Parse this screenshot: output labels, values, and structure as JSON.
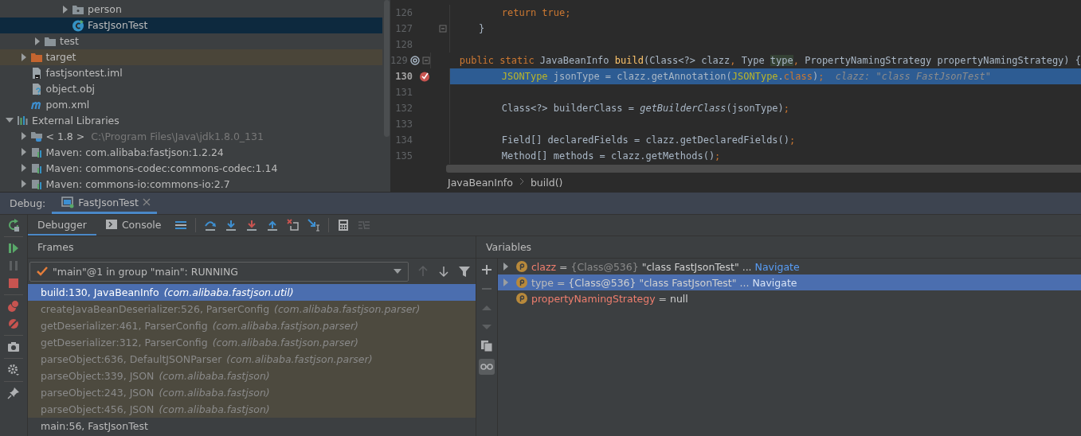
{
  "project_tree": [
    {
      "children": [
        {
          "children": [
            {
              "children": [
                {
                  "children": [
                    {
                      "label": "person",
                      "kind": "package",
                      "expanded": false,
                      "selected": false,
                      "ignored": false
                    },
                    {
                      "label": "FastJsonTest",
                      "kind": "class",
                      "selected": true,
                      "ignored": false
                    }
                  ]
                }
              ]
            },
            {
              "label": "test",
              "kind": "folder",
              "expanded": false,
              "selected": false,
              "ignored": false
            }
          ]
        },
        {
          "label": "target",
          "kind": "excluded_folder",
          "expanded": false,
          "selected": false,
          "ignored": true
        },
        {
          "label": "fastjsontest.iml",
          "kind": "module_file",
          "selected": false,
          "ignored": false
        },
        {
          "label": "object.obj",
          "kind": "unknown_file",
          "selected": false,
          "ignored": false
        },
        {
          "label": "pom.xml",
          "kind": "maven_file",
          "selected": false,
          "ignored": false
        }
      ]
    },
    {
      "label": "External Libraries",
      "kind": "libraries",
      "expanded": true,
      "selected": false,
      "ignored": false,
      "children": [
        {
          "label": "< 1.8 >",
          "path": "C:\\Program Files\\Java\\jdk1.8.0_131",
          "kind": "jdk",
          "expanded": false,
          "selected": false,
          "ignored": false
        },
        {
          "label": "Maven: com.alibaba:fastjson:1.2.24",
          "kind": "library",
          "expanded": false,
          "selected": false,
          "ignored": false
        },
        {
          "label": "Maven: commons-codec:commons-codec:1.14",
          "kind": "library",
          "expanded": false,
          "selected": false,
          "ignored": false
        },
        {
          "label": "Maven: commons-io:commons-io:2.7",
          "kind": "library",
          "expanded": false,
          "selected": false,
          "ignored": false
        }
      ]
    }
  ],
  "editor": {
    "lines": [
      {
        "number": "126",
        "current": false,
        "overrides": false,
        "breakpoint": false,
        "fold": false,
        "tokens": [
          {
            "kind": "keyword",
            "text": "        return true;"
          }
        ]
      },
      {
        "number": "127",
        "current": false,
        "overrides": false,
        "breakpoint": false,
        "fold": true,
        "tokens": [
          {
            "kind": "plain",
            "text": "    }"
          }
        ]
      },
      {
        "number": "128",
        "current": false,
        "overrides": false,
        "breakpoint": false,
        "fold": false
      },
      {
        "number": "129",
        "current": false,
        "overrides": true,
        "breakpoint": false,
        "fold": true,
        "tokens": [
          {
            "kind": "keyword",
            "text": "    public static "
          },
          {
            "kind": "plain",
            "text": "JavaBeanInfo "
          },
          {
            "kind": "method",
            "text": "build"
          },
          {
            "kind": "plain",
            "text": "(Class<?> clazz"
          },
          {
            "kind": "keyword",
            "text": ", "
          },
          {
            "kind": "plain",
            "text": "Type "
          },
          {
            "kind": "usage",
            "text": "type"
          },
          {
            "kind": "keyword",
            "text": ", "
          },
          {
            "kind": "plain",
            "text": "PropertyNamingStrategy propertyNamingStrategy) {"
          }
        ]
      },
      {
        "number": "130",
        "current": true,
        "overrides": false,
        "breakpoint": true,
        "fold": false,
        "tokens": [
          {
            "kind": "annotation",
            "text": "        JSONType"
          },
          {
            "kind": "plain",
            "text": " jsonType = clazz.getAnnotation("
          },
          {
            "kind": "annotation",
            "text": "JSONType"
          },
          {
            "kind": "plain",
            "text": "."
          },
          {
            "kind": "keyword",
            "text": "class"
          },
          {
            "kind": "plain",
            "text": ")"
          },
          {
            "kind": "keyword",
            "text": ";"
          },
          {
            "kind": "hint",
            "text": "  clazz: \"class FastJsonTest\""
          }
        ]
      },
      {
        "number": "131",
        "current": false,
        "overrides": false,
        "breakpoint": false,
        "fold": false
      },
      {
        "number": "132",
        "current": false,
        "overrides": false,
        "breakpoint": false,
        "fold": false,
        "tokens": [
          {
            "kind": "plain",
            "text": "        Class<?> builderClass = "
          },
          {
            "kind": "static_call",
            "text": "getBuilderClass"
          },
          {
            "kind": "plain",
            "text": "(jsonType)"
          },
          {
            "kind": "keyword",
            "text": ";"
          }
        ]
      },
      {
        "number": "133",
        "current": false,
        "overrides": false,
        "breakpoint": false,
        "fold": false
      },
      {
        "number": "134",
        "current": false,
        "overrides": false,
        "breakpoint": false,
        "fold": false,
        "tokens": [
          {
            "kind": "plain",
            "text": "        Field[] declaredFields = clazz.getDeclaredFields()"
          },
          {
            "kind": "keyword",
            "text": ";"
          }
        ]
      },
      {
        "number": "135",
        "current": false,
        "overrides": false,
        "breakpoint": false,
        "fold": false,
        "tokens": [
          {
            "kind": "plain",
            "text": "        Method[] methods = clazz.getMethods()"
          },
          {
            "kind": "keyword",
            "text": ";"
          }
        ]
      }
    ],
    "breadcrumb": [
      "JavaBeanInfo",
      "build()"
    ]
  },
  "debug": {
    "label": "Debug:",
    "tabs": [
      {
        "label": "FastJsonTest",
        "selected": true
      }
    ]
  },
  "debug_tabs": [
    {
      "label": "Debugger",
      "kind": "plain",
      "selected": true
    },
    {
      "label": "Console",
      "kind": "console",
      "selected": false
    }
  ],
  "frames": {
    "title": "Frames",
    "thread": "\"main\"@1 in group \"main\": RUNNING",
    "items": [
      {
        "method": "build:130, JavaBeanInfo",
        "package": "(com.alibaba.fastjson.util)",
        "selected": true,
        "library": false
      },
      {
        "method": "createJavaBeanDeserializer:526, ParserConfig",
        "package": "(com.alibaba.fastjson.parser)",
        "selected": false,
        "library": true
      },
      {
        "method": "getDeserializer:461, ParserConfig",
        "package": "(com.alibaba.fastjson.parser)",
        "selected": false,
        "library": true
      },
      {
        "method": "getDeserializer:312, ParserConfig",
        "package": "(com.alibaba.fastjson.parser)",
        "selected": false,
        "library": true
      },
      {
        "method": "parseObject:636, DefaultJSONParser",
        "package": "(com.alibaba.fastjson.parser)",
        "selected": false,
        "library": true
      },
      {
        "method": "parseObject:339, JSON",
        "package": "(com.alibaba.fastjson)",
        "selected": false,
        "library": true
      },
      {
        "method": "parseObject:243, JSON",
        "package": "(com.alibaba.fastjson)",
        "selected": false,
        "library": true
      },
      {
        "method": "parseObject:456, JSON",
        "package": "(com.alibaba.fastjson)",
        "selected": false,
        "library": true
      },
      {
        "method": "main:56, FastJsonTest",
        "selected": false,
        "library": false
      }
    ]
  },
  "variables": {
    "title": "Variables",
    "watches_shown": true,
    "items": [
      {
        "name": "clazz",
        "operator": "=",
        "value_type": "{Class@536}",
        "value": "\"class FastJsonTest\"",
        "ellipsis": "...",
        "link": "Navigate",
        "expandable": true,
        "selected": false
      },
      {
        "name": "type",
        "operator": "=",
        "value_type": "{Class@536}",
        "value": "\"class FastJsonTest\"",
        "ellipsis": "...",
        "link": "Navigate",
        "expandable": true,
        "selected": true
      },
      {
        "name": "propertyNamingStrategy",
        "operator": "=",
        "value": "null",
        "expandable": false,
        "selected": false
      }
    ]
  }
}
